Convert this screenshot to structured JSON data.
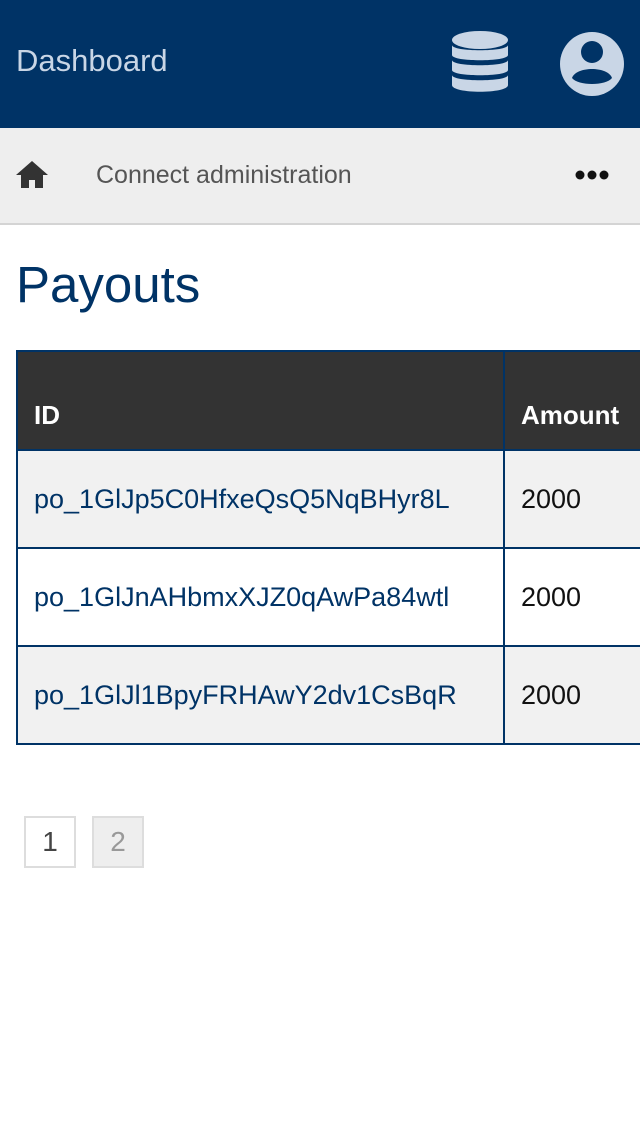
{
  "header": {
    "title": "Dashboard",
    "icons": [
      "database-icon",
      "user-account-icon"
    ],
    "color": "#003366"
  },
  "nav": {
    "home_icon": "home-icon",
    "breadcrumb": "Connect administration",
    "more_icon": "more-horizontal-icon"
  },
  "page": {
    "title": "Payouts"
  },
  "table": {
    "columns": [
      "ID",
      "Amount"
    ],
    "rows": [
      {
        "id": "po_1GlJp5C0HfxeQsQ5NqBHyr8L",
        "amount": "2000"
      },
      {
        "id": "po_1GlJnAHbmxXJZ0qAwPa84wtl",
        "amount": "2000"
      },
      {
        "id": "po_1GlJl1BpyFRHAwY2dv1CsBqR",
        "amount": "2000"
      }
    ]
  },
  "pagination": {
    "pages": [
      "1",
      "2"
    ]
  }
}
